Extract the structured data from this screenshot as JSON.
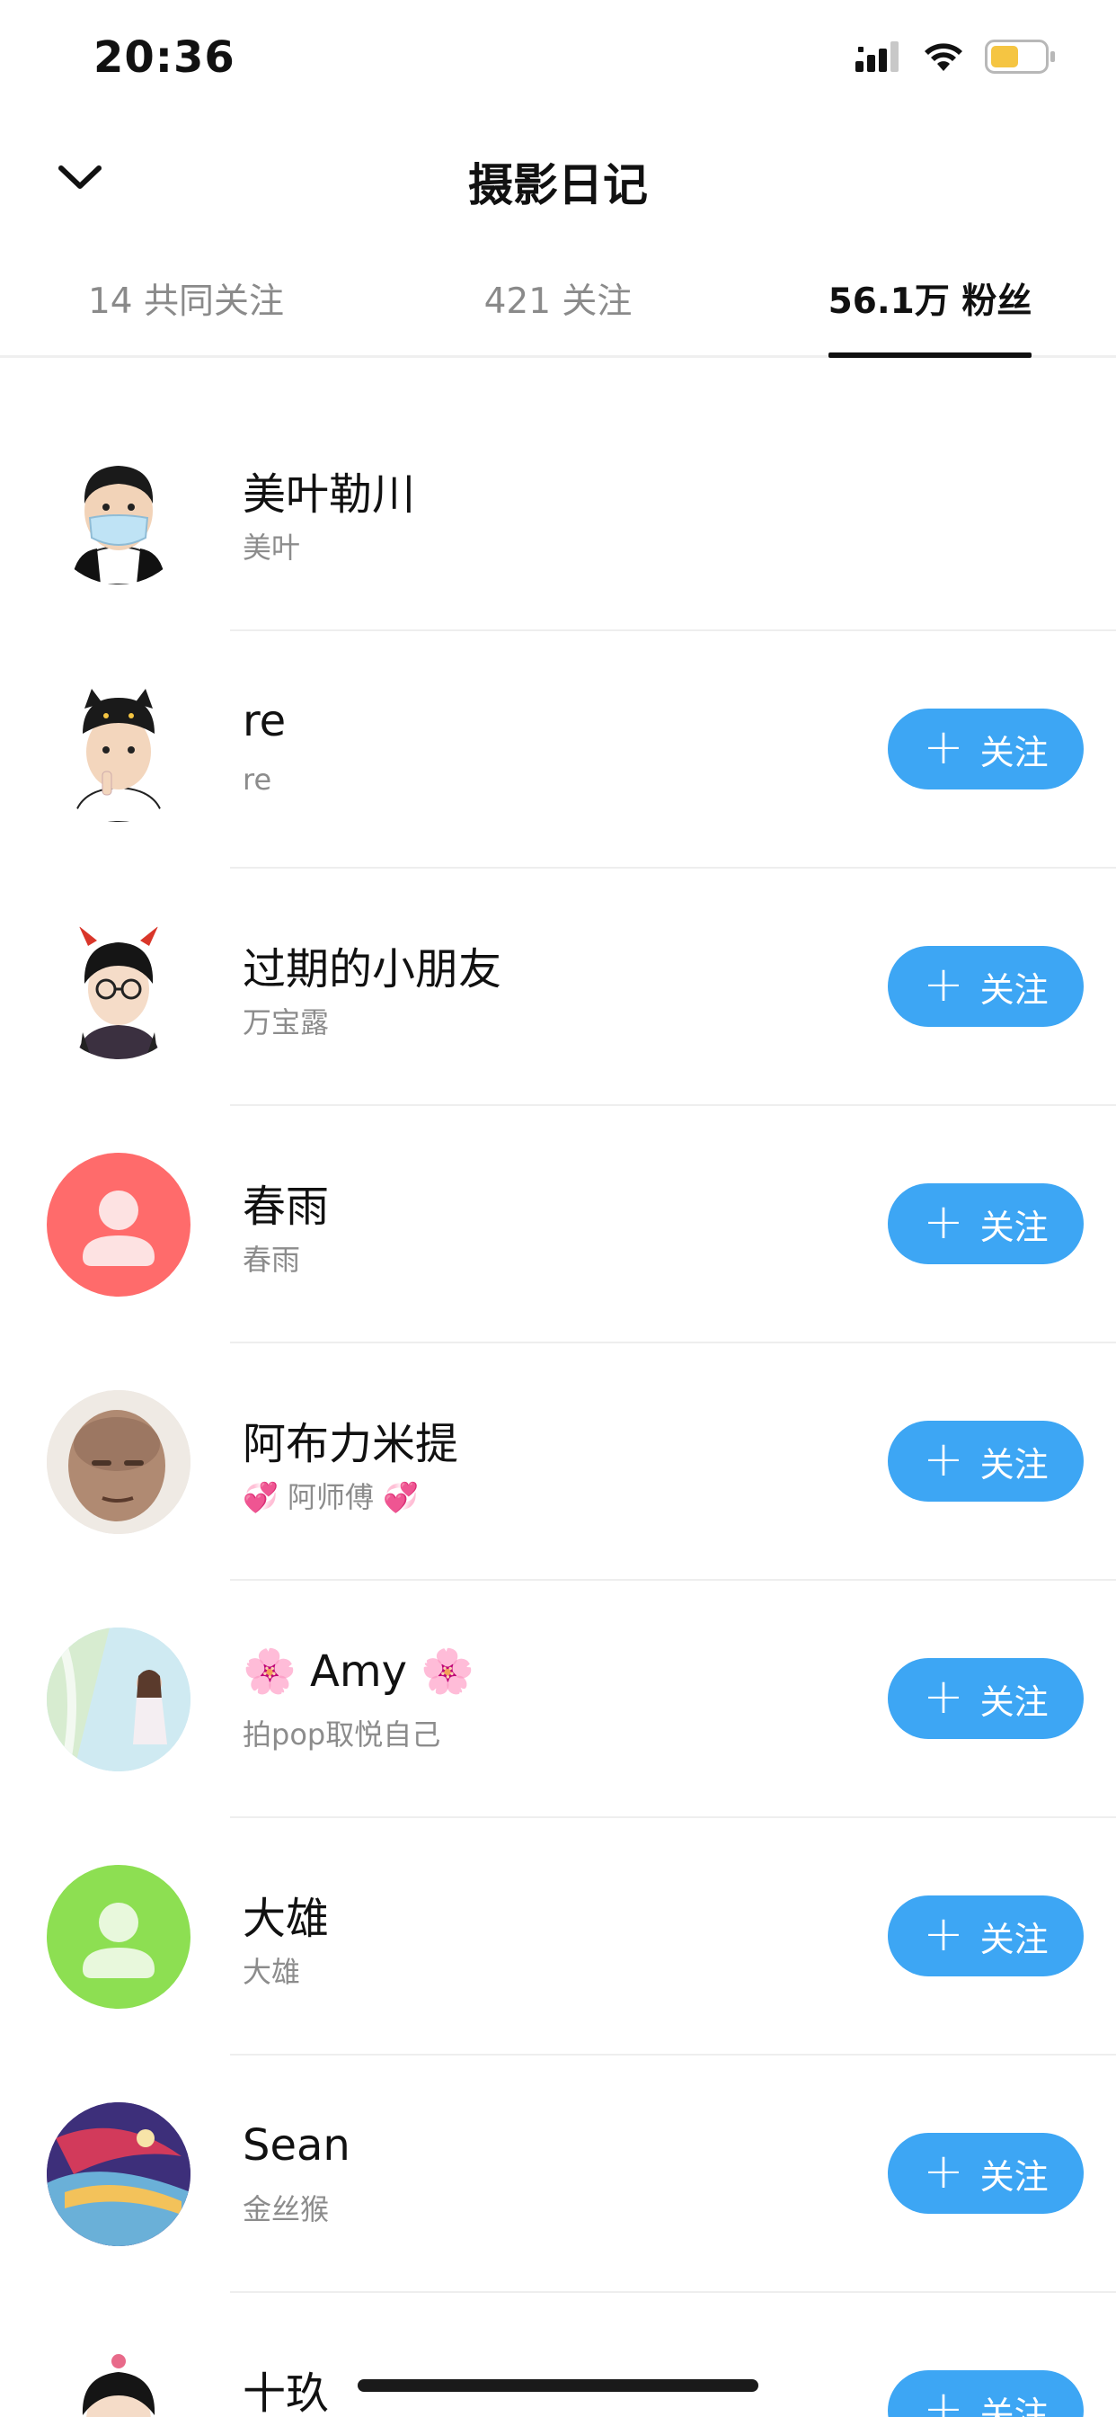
{
  "status": {
    "time": "20:36"
  },
  "nav": {
    "title": "摄影日记"
  },
  "tabs": [
    {
      "label": "14 共同关注"
    },
    {
      "label": "421 关注"
    },
    {
      "label": "56.1万 粉丝"
    }
  ],
  "follow_label": "关注",
  "users": [
    {
      "name": "美叶勒川",
      "sub": "美叶",
      "avatar": "cartoon-boy-mask-avatar",
      "follow": false
    },
    {
      "name": "re",
      "sub": "re",
      "avatar": "cartoon-boy-cat-hat-avatar",
      "follow": true
    },
    {
      "name": "过期的小朋友",
      "sub": "万宝露",
      "avatar": "cartoon-girl-devil-horns-avatar",
      "follow": true
    },
    {
      "name": "春雨",
      "sub": "春雨",
      "avatar": "default-user-icon",
      "avatar_color": "#ff6b6b",
      "follow": true
    },
    {
      "name": "阿布力米提",
      "sub": "💞 阿师傅 💞",
      "avatar": "photo-man-avatar",
      "follow": true
    },
    {
      "name": "🌸 Amy 🌸",
      "sub": "拍pop取悦自己",
      "avatar": "photo-pool-girl-avatar",
      "follow": true
    },
    {
      "name": "大雄",
      "sub": "大雄",
      "avatar": "default-user-icon",
      "avatar_color": "#8ddf52",
      "follow": true
    },
    {
      "name": "Sean",
      "sub": "金丝猴",
      "avatar": "colorful-art-avatar",
      "follow": true
    },
    {
      "name": "十玖",
      "sub": "",
      "avatar": "cartoon-girl-avatar",
      "follow": true
    }
  ]
}
